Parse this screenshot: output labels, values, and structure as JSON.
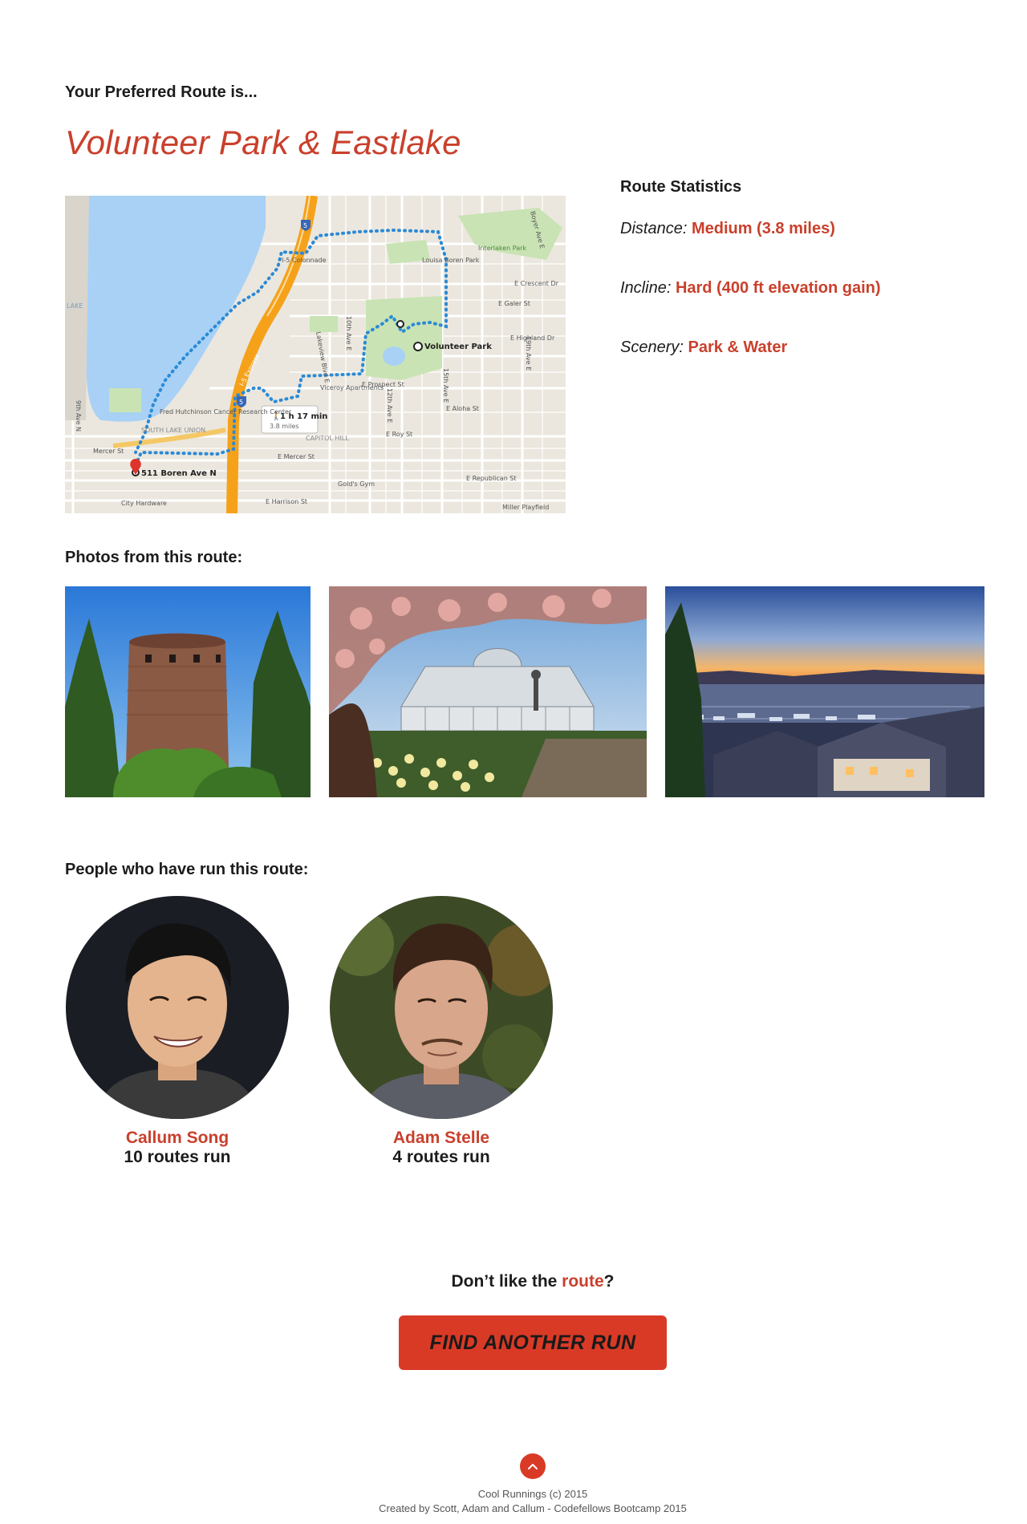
{
  "header": {
    "pre_title": "Your Preferred Route is...",
    "route_name": "Volunteer Park & Eastlake"
  },
  "map": {
    "labels": {
      "destination": "Volunteer Park",
      "origin": "511 Boren Ave N",
      "duration": "1 h 17 min",
      "distance": "3.8 miles",
      "hospital": "Fred Hutchinson Cancer Research Center",
      "park2": "Louisa Boren Park",
      "park3": "Interlaken Park",
      "colonnade": "I-5 Colonnade",
      "neighborhood1": "SOUTH LAKE UNION",
      "neighborhood2": "CAPITOL HILL",
      "lake": "LAKE",
      "st1": "Mercer St",
      "st2": "E Aloha St",
      "st3": "E Prospect St",
      "st4": "E Roy St",
      "st5": "E Mercer St",
      "st6": "E Republican St",
      "st7": "E Harrison St",
      "st8": "E Galer St",
      "st9": "E Highland Dr",
      "st10": "E Crescent Dr",
      "ave1": "10th Ave E",
      "ave2": "12th Ave E",
      "ave3": "15th Ave E",
      "ave4": "19th Ave E",
      "ave5": "Boyer Ave E",
      "ave6": "9th Ave N",
      "ave7": "Lakeview Blvd E",
      "poi1": "Viceroy Apartments",
      "poi2": "Gold's Gym",
      "poi3": "City Hardware",
      "poi4": "Miller Playfield",
      "hwy": "I-5 Express",
      "shield": "5"
    }
  },
  "stats": {
    "title": "Route Statistics",
    "distance_label": "Distance:",
    "distance_value": "Medium (3.8 miles)",
    "incline_label": "Incline:",
    "incline_value": "Hard (400 ft elevation gain)",
    "scenery_label": "Scenery:",
    "scenery_value": "Park & Water"
  },
  "photos": {
    "title": "Photos from this route:",
    "items": [
      "water-tower",
      "conservatory",
      "lake-sunset"
    ]
  },
  "people": {
    "title": "People who have run this route:",
    "items": [
      {
        "name": "Callum Song",
        "count": "10 routes run"
      },
      {
        "name": "Adam Stelle",
        "count": "4 routes run"
      }
    ]
  },
  "cta": {
    "prefix": "Don’t like the ",
    "link": "route",
    "suffix": "?",
    "button": "FIND ANOTHER RUN"
  },
  "footer": {
    "line1": "Cool Runnings (c) 2015",
    "line2": "Created by Scott, Adam and Callum - Codefellows Bootcamp 2015"
  },
  "colors": {
    "accent": "#c9402c",
    "button": "#d93a26",
    "route_line": "#2b8ad6",
    "highway": "#f5a21a"
  }
}
